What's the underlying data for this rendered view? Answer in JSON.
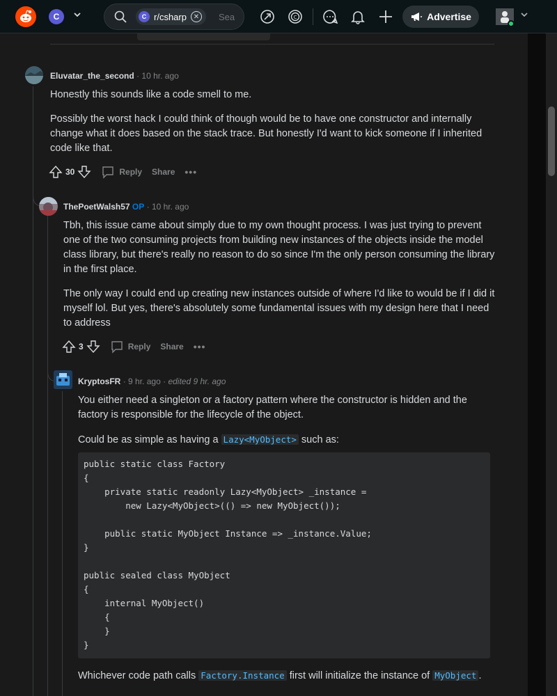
{
  "topbar": {
    "subreddit_chip": "r/csharp",
    "search_placeholder": "Sea",
    "advertise_label": "Advertise",
    "icons": [
      "reddit-logo",
      "csharp-icon",
      "chevron-down-icon",
      "search-icon",
      "close-icon",
      "popular-icon",
      "coins-icon",
      "chat-icon",
      "bell-icon",
      "plus-icon",
      "megaphone-icon",
      "user-avatar"
    ]
  },
  "comments": [
    {
      "author": "Eluvatar_the_second",
      "op_badge": "",
      "time": "10 hr. ago",
      "edited": "",
      "paragraphs": [
        "Honestly this sounds like a code smell to me.",
        "Possibly the worst hack I could think of though would be to have one constructor and internally change what it does based on the stack trace. But honestly I'd want to kick someone if I inherited code like that."
      ],
      "votes": "30",
      "reply_label": "Reply",
      "share_label": "Share"
    },
    {
      "author": "ThePoetWalsh57",
      "op_badge": "OP",
      "time": "10 hr. ago",
      "edited": "",
      "paragraphs": [
        "Tbh, this issue came about simply due to my own thought process. I was just trying to prevent one of the two consuming projects from building new instances of the objects inside the model class library, but there's really no reason to do so since I'm the only person consuming the library in the first place.",
        "The only way I could end up creating new instances outside of where I'd like to would be if I did it myself lol. But yes, there's absolutely some fundamental issues with my design here that I need to address"
      ],
      "votes": "3",
      "reply_label": "Reply",
      "share_label": "Share"
    },
    {
      "author": "KryptosFR",
      "op_badge": "",
      "time": "9 hr. ago",
      "edited": "edited 9 hr. ago",
      "p1": "You either need a singleton or a factory pattern where the constructor is hidden and the factory is responsible for the lifecycle of the object.",
      "p2_before": "Could be as simple as having a ",
      "p2_code": "Lazy<MyObject>",
      "p2_after": " such as:",
      "code": "public static class Factory\n{\n    private static readonly Lazy<MyObject> _instance =\n        new Lazy<MyObject>(() => new MyObject());\n\n    public static MyObject Instance => _instance.Value;\n}\n\npublic sealed class MyObject\n{\n    internal MyObject()\n    {\n    }\n}",
      "p3_before": "Whichever code path calls ",
      "p3_code1": "Factory.Instance",
      "p3_mid": " first will initialize the instance of ",
      "p3_code2": "MyObject",
      "p3_after": "."
    }
  ]
}
